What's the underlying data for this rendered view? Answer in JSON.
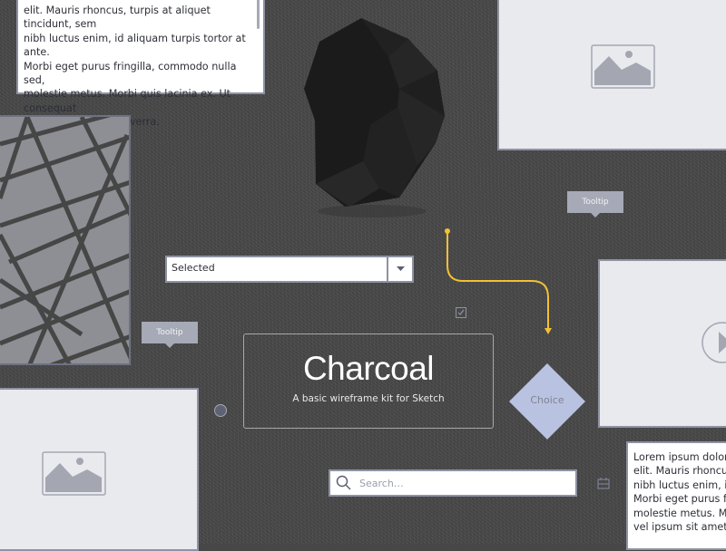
{
  "text_card_top": {
    "lines": [
      "elit. Mauris rhoncus, turpis at aliquet tincidunt, sem",
      "nibh luctus enim, id aliquam turpis tortor at ante.",
      "Morbi eget purus fringilla, commodo nulla sed,",
      "molestie metus. Morbi quis lacinia ex. Ut consequat",
      "vel ipsum sit amet viverra."
    ]
  },
  "text_card_bottom": {
    "lines": [
      "Lorem ipsum dolor sit amet, consectetur adipiscing",
      "elit. Mauris rhoncus, turpis at aliquet tincidunt, sem",
      "nibh luctus enim, id aliquam turpis tortor at ante.",
      "Morbi eget purus fringilla, commodo nulla sed,",
      "molestie metus. Morbi quis lacinia ex. Ut consequat",
      "vel ipsum sit amet viverra."
    ]
  },
  "tooltips": {
    "right": "Tooltip",
    "left": "Tooltip"
  },
  "select": {
    "value": "Selected"
  },
  "hero": {
    "title": "Charcoal",
    "subtitle": "A basic wireframe kit for Sketch"
  },
  "decision": {
    "label": "Choice"
  },
  "search": {
    "placeholder": "Search…"
  },
  "colors": {
    "background": "#474747",
    "accent_connector": "#f2c035",
    "placeholder_fill": "#e9eaee",
    "border": "#8e92a3",
    "decision_fill": "#b9c2e0"
  }
}
